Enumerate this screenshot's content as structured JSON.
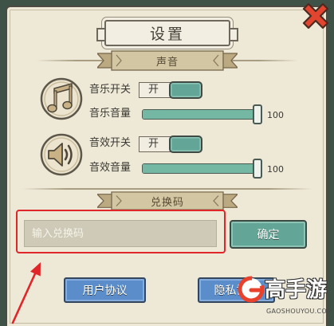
{
  "dialog": {
    "title": "设置",
    "close_icon": "close-icon"
  },
  "sound": {
    "header": "声音",
    "music": {
      "icon": "music-note-icon",
      "toggle_label": "音乐开关",
      "toggle_state": "开",
      "volume_label": "音乐音量",
      "volume_level": 1.0,
      "volume_value": 100
    },
    "effects": {
      "icon": "speaker-icon",
      "toggle_label": "音效开关",
      "toggle_state": "开",
      "volume_label": "音效音量",
      "volume_level": 1.0,
      "volume_value": 100
    }
  },
  "redeem": {
    "header": "兑换码",
    "input_placeholder": "输入兑换码",
    "input_value": "",
    "confirm_label": "确定"
  },
  "footer": {
    "user_agreement_label": "用户协议",
    "privacy_agreement_label": "隐私协议"
  },
  "annotation": {
    "arrow_icon": "pointer-arrow-icon"
  },
  "watermark": {
    "logo_icon": "gaoshouyou-logo-icon",
    "brand": "高手游",
    "site": "GAOSHOUYOU.COM"
  },
  "colors": {
    "frame": "#3e5247",
    "panel": "#eee8d6",
    "accent": "#63a697",
    "slider_fill": "#74b8a4",
    "button_blue": "#5a8dca",
    "close_red": "#e2452f",
    "highlight_red": "#e1262a"
  }
}
